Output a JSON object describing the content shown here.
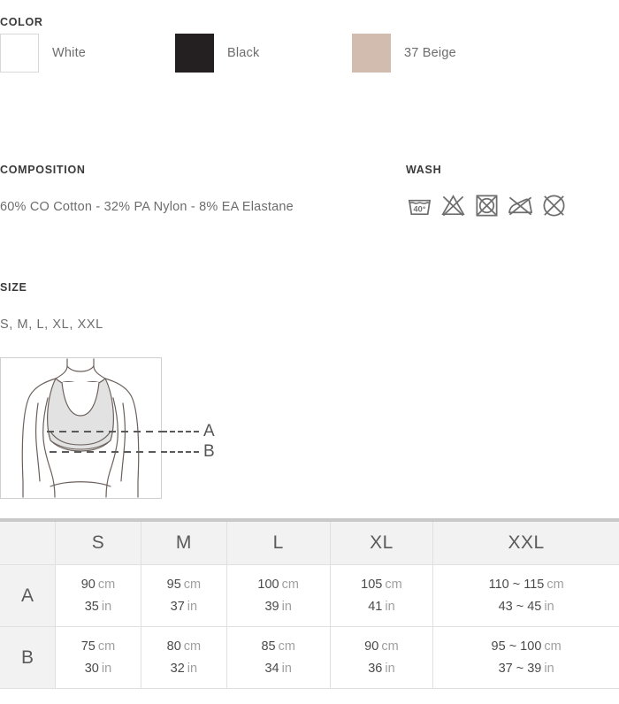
{
  "color": {
    "heading": "COLOR",
    "swatches": [
      {
        "name": "White",
        "hex": "#ffffff",
        "icon": "color-swatch-white"
      },
      {
        "name": "Black",
        "hex": "#241f20",
        "icon": "color-swatch-black"
      },
      {
        "name": "37 Beige",
        "hex": "#d2bcaf",
        "icon": "color-swatch-beige"
      }
    ]
  },
  "composition": {
    "heading": "COMPOSITION",
    "text": "60% CO Cotton - 32% PA Nylon  - 8% EA Elastane"
  },
  "wash": {
    "heading": "WASH",
    "icons": [
      {
        "name": "wash-40-degrees-icon",
        "label": "40°"
      },
      {
        "name": "do-not-bleach-icon",
        "label": ""
      },
      {
        "name": "do-not-tumble-dry-icon",
        "label": ""
      },
      {
        "name": "do-not-iron-icon",
        "label": ""
      },
      {
        "name": "do-not-dry-clean-icon",
        "label": ""
      }
    ]
  },
  "size": {
    "heading": "SIZE",
    "list": "S, M, L, XL, XXL"
  },
  "diagram": {
    "callouts": [
      {
        "letter": "A"
      },
      {
        "letter": "B"
      }
    ]
  },
  "table": {
    "columns": [
      "",
      "S",
      "M",
      "L",
      "XL",
      "XXL"
    ],
    "rows": [
      {
        "label": "A",
        "cells": [
          {
            "cm_value": "90",
            "cm_unit": "cm",
            "in_value": "35",
            "in_unit": "in"
          },
          {
            "cm_value": "95",
            "cm_unit": "cm",
            "in_value": "37",
            "in_unit": "in"
          },
          {
            "cm_value": "100",
            "cm_unit": "cm",
            "in_value": "39",
            "in_unit": "in"
          },
          {
            "cm_value": "105",
            "cm_unit": "cm",
            "in_value": "41",
            "in_unit": "in"
          },
          {
            "cm_value": "110 ~ 115",
            "cm_unit": "cm",
            "in_value": "43 ~ 45",
            "in_unit": "in"
          }
        ]
      },
      {
        "label": "B",
        "cells": [
          {
            "cm_value": "75",
            "cm_unit": "cm",
            "in_value": "30",
            "in_unit": "in"
          },
          {
            "cm_value": "80",
            "cm_unit": "cm",
            "in_value": "32",
            "in_unit": "in"
          },
          {
            "cm_value": "85",
            "cm_unit": "cm",
            "in_value": "34",
            "in_unit": "in"
          },
          {
            "cm_value": "90",
            "cm_unit": "cm",
            "in_value": "36",
            "in_unit": "in"
          },
          {
            "cm_value": "95 ~ 100",
            "cm_unit": "cm",
            "in_value": "37 ~ 39",
            "in_unit": "in"
          }
        ]
      }
    ]
  }
}
